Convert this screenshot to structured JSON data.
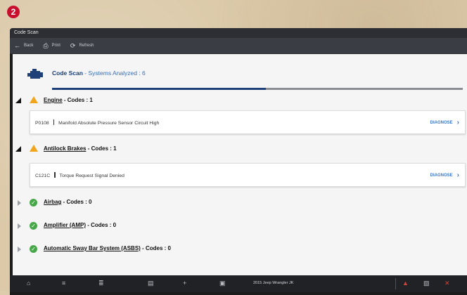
{
  "step_badge": "2",
  "window": {
    "title": "Code Scan"
  },
  "toolbar": {
    "back_label": "Back",
    "print_label": "Print",
    "refresh_label": "Refresh"
  },
  "header": {
    "title": "Code Scan",
    "subtitle": " - Systems Analyzed : 6",
    "progress_fraction": 0.52
  },
  "sections": [
    {
      "name": "Engine",
      "codes_text": " - Codes : 1",
      "status": "warning",
      "expanded": true,
      "code": {
        "id": "P0108",
        "description": "Manifold Absolute Pressure Sensor Circuit High",
        "action": "DIAGNOSE"
      }
    },
    {
      "name": "Antilock Brakes",
      "codes_text": " - Codes : 1",
      "status": "warning",
      "expanded": true,
      "code": {
        "id": "C121C",
        "description": "Torque Request Signal Denied",
        "action": "DIAGNOSE"
      }
    },
    {
      "name": "Airbag",
      "codes_text": " - Codes : 0",
      "status": "ok",
      "expanded": false
    },
    {
      "name": "Amplifier (AMP)",
      "codes_text": " - Codes : 0",
      "status": "ok",
      "expanded": false
    },
    {
      "name": "Automatic Sway Bar System (ASBS)",
      "codes_text": " - Codes : 0",
      "status": "ok",
      "expanded": false
    }
  ],
  "bottom_bar": {
    "vehicle": "2015 Jeep Wrangler JK",
    "icons": [
      "home-icon",
      "tools-icon",
      "list-icon",
      "data-icon",
      "plus-icon",
      "folder-icon",
      "car-icon",
      "vci-icon",
      "shop-icon"
    ]
  },
  "colors": {
    "title_blue": "#1a3f7a",
    "progress": "#1f3f78",
    "warning": "#f0a51c",
    "ok": "#47a84a",
    "link": "#3c78c8"
  }
}
